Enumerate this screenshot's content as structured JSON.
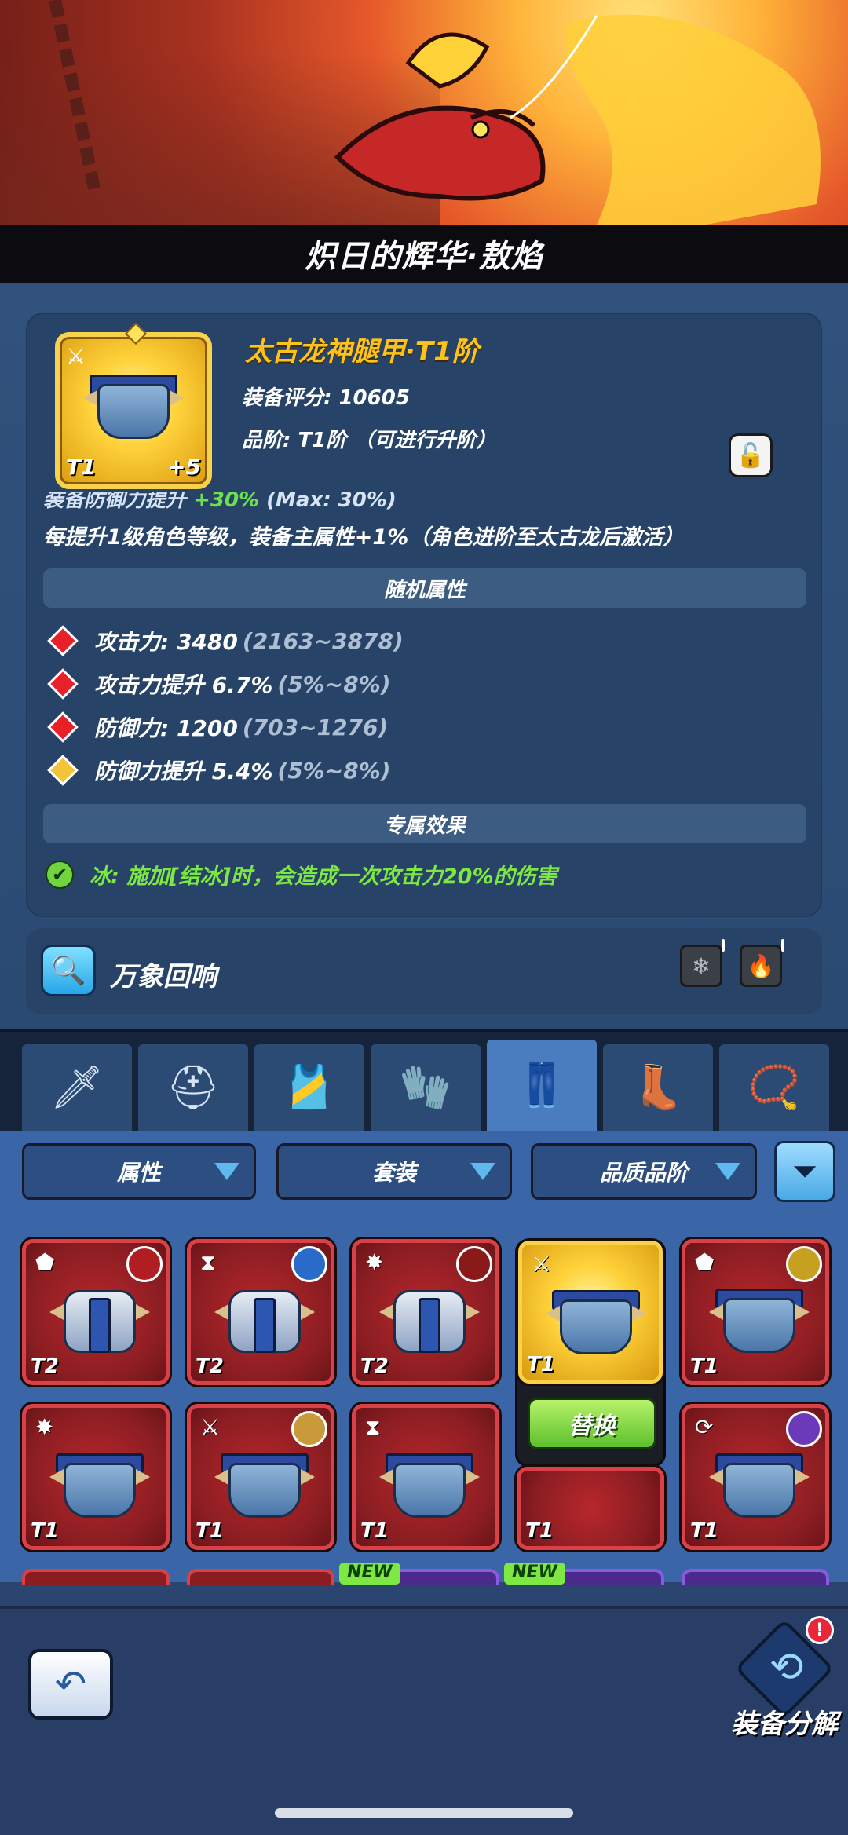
{
  "banner": {
    "title": "炽日的辉华·敖焰"
  },
  "item": {
    "name": "太古龙神腿甲·T1阶",
    "score": "装备评分: 10605",
    "grade": "品阶: T1阶 （可进行升阶）",
    "thumb_tier": "T1",
    "thumb_plus": "+5"
  },
  "main_attr": {
    "cut_text_prefix": "装备防御力提升 ",
    "cut_text_value": "+30%",
    "cut_text_suffix": " (Max: 30%)",
    "desc": "每提升1级角色等级，装备主属性+1%（角色进阶至太古龙后激活）"
  },
  "random_section": {
    "header": "随机属性",
    "stats": [
      {
        "label": "攻击力: 3480",
        "range": "(2163~3878)",
        "color": "red"
      },
      {
        "label": "攻击力提升 6.7%",
        "range": "(5%~8%)",
        "color": "red"
      },
      {
        "label": "防御力: 1200",
        "range": "(703~1276)",
        "color": "red"
      },
      {
        "label": "防御力提升 5.4%",
        "range": "(5%~8%)",
        "color": "gold"
      }
    ]
  },
  "special_section": {
    "header": "专属效果",
    "effect": "冰: 施加[结冰]时，会造成一次攻击力20%的伤害"
  },
  "echo": {
    "label": "万象回响",
    "icons": [
      "snowflake-icon",
      "fire-icon"
    ]
  },
  "slot_tabs": [
    {
      "name": "weapon",
      "glyph": "🗡",
      "active": false
    },
    {
      "name": "helmet",
      "glyph": "⛑",
      "active": false
    },
    {
      "name": "armor",
      "glyph": "🎽",
      "active": false
    },
    {
      "name": "bracer",
      "glyph": "🧤",
      "active": false
    },
    {
      "name": "legs",
      "glyph": "👖",
      "active": true
    },
    {
      "name": "boots",
      "glyph": "👢",
      "active": false
    },
    {
      "name": "necklace",
      "glyph": "📿",
      "active": false
    }
  ],
  "filters": {
    "attribute": "属性",
    "set": "套装",
    "quality": "品质品阶"
  },
  "inventory": {
    "row1": [
      {
        "tier": "T2",
        "mark": "⬟",
        "kind": "torso"
      },
      {
        "tier": "T2",
        "mark": "⧗",
        "kind": "torso"
      },
      {
        "tier": "T2",
        "mark": "✸",
        "kind": "torso"
      },
      {
        "tier": "T1",
        "mark": "⚔",
        "kind": "legs",
        "gold": true
      },
      {
        "tier": "T1",
        "mark": "⬟",
        "kind": "legs"
      }
    ],
    "row2": [
      {
        "tier": "T1",
        "mark": "✸",
        "kind": "legs"
      },
      {
        "tier": "T1",
        "mark": "⚔",
        "kind": "legs"
      },
      {
        "tier": "T1",
        "mark": "⧗",
        "kind": "legs"
      },
      {
        "tier": "T1",
        "mark": "",
        "kind": "legs"
      },
      {
        "tier": "T1",
        "mark": "⟳",
        "kind": "legs"
      }
    ],
    "replace_label": "替换",
    "new_tag": "NEW"
  },
  "bottom": {
    "salvage_label": "装备分解",
    "salvage_badge": "!"
  }
}
